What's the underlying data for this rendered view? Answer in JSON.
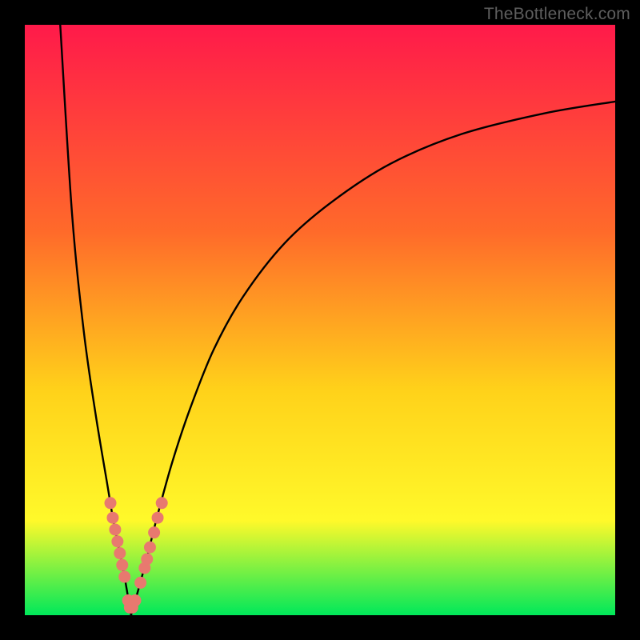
{
  "watermark": "TheBottleneck.com",
  "colors": {
    "frame": "#000000",
    "gradient_top": "#ff1a4a",
    "gradient_mid1": "#ff6a2a",
    "gradient_mid2": "#ffd21a",
    "gradient_mid3": "#fff92a",
    "gradient_bottom": "#00e85a",
    "curve": "#000000",
    "marker_fill": "#e8796f",
    "marker_stroke": "#c85a52"
  },
  "chart_data": {
    "type": "line",
    "title": "",
    "xlabel": "",
    "ylabel": "",
    "xlim": [
      0,
      100
    ],
    "ylim": [
      0,
      100
    ],
    "grid": false,
    "legend": false,
    "series": [
      {
        "name": "left-branch",
        "x": [
          6.0,
          8.0,
          10.0,
          12.0,
          14.0,
          15.0,
          16.0,
          16.8,
          17.5,
          18.0
        ],
        "y": [
          100.0,
          68.0,
          48.0,
          34.0,
          22.0,
          16.0,
          11.0,
          7.0,
          3.0,
          0.0
        ]
      },
      {
        "name": "right-branch",
        "x": [
          18.0,
          19.0,
          20.5,
          22.5,
          25.0,
          28.0,
          32.0,
          37.0,
          44.0,
          52.0,
          62.0,
          74.0,
          88.0,
          100.0
        ],
        "y": [
          0.0,
          3.5,
          9.0,
          17.0,
          26.0,
          35.0,
          45.0,
          54.0,
          63.0,
          70.0,
          76.5,
          81.5,
          85.0,
          87.0
        ]
      }
    ],
    "markers": [
      {
        "x": 14.5,
        "y": 19.0
      },
      {
        "x": 14.9,
        "y": 16.5
      },
      {
        "x": 15.3,
        "y": 14.5
      },
      {
        "x": 15.7,
        "y": 12.5
      },
      {
        "x": 16.1,
        "y": 10.5
      },
      {
        "x": 16.5,
        "y": 8.5
      },
      {
        "x": 16.9,
        "y": 6.5
      },
      {
        "x": 17.5,
        "y": 2.5
      },
      {
        "x": 17.8,
        "y": 1.3
      },
      {
        "x": 18.2,
        "y": 1.3
      },
      {
        "x": 18.7,
        "y": 2.5
      },
      {
        "x": 19.6,
        "y": 5.5
      },
      {
        "x": 20.3,
        "y": 8.0
      },
      {
        "x": 20.7,
        "y": 9.5
      },
      {
        "x": 21.2,
        "y": 11.5
      },
      {
        "x": 21.9,
        "y": 14.0
      },
      {
        "x": 22.5,
        "y": 16.5
      },
      {
        "x": 23.2,
        "y": 19.0
      }
    ]
  }
}
